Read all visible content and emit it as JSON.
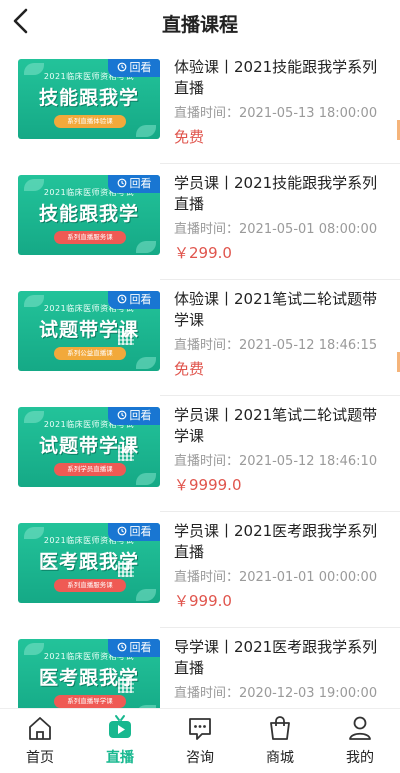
{
  "header": {
    "title": "直播课程"
  },
  "courses": [
    {
      "title": "体验课丨2021技能跟我学系列直播",
      "time_label": "直播时间：",
      "time": "2021-05-13 18:00:00",
      "price": "免费",
      "badge": "回看",
      "thumb": {
        "subtitle": "2021临床医师资格考试",
        "big": "技能跟我学",
        "pill": "系列直播体验课",
        "pill_color": "#f2a93b"
      }
    },
    {
      "title": "学员课丨2021技能跟我学系列直播",
      "time_label": "直播时间：",
      "time": "2021-05-01 08:00:00",
      "price": "￥299.0",
      "badge": "回看",
      "thumb": {
        "subtitle": "2021临床医师资格考试",
        "big": "技能跟我学",
        "pill": "系列直播服务课",
        "pill_color": "#ef5a54"
      }
    },
    {
      "title": "体验课丨2021笔试二轮试题带学课",
      "time_label": "直播时间：",
      "time": "2021-05-12 18:46:15",
      "price": "免费",
      "badge": "回看",
      "thumb": {
        "subtitle": "2021临床医师资格考试",
        "big": "试题带学课",
        "pill": "系列公益直播课",
        "pill_color": "#f2a93b"
      }
    },
    {
      "title": "学员课丨2021笔试二轮试题带学课",
      "time_label": "直播时间：",
      "time": "2021-05-12 18:46:10",
      "price": "￥9999.0",
      "badge": "回看",
      "thumb": {
        "subtitle": "2021临床医师资格考试",
        "big": "试题带学课",
        "pill": "系列学员直播课",
        "pill_color": "#ef5a54"
      }
    },
    {
      "title": "学员课丨2021医考跟我学系列直播",
      "time_label": "直播时间：",
      "time": "2021-01-01 00:00:00",
      "price": "￥999.0",
      "badge": "回看",
      "thumb": {
        "subtitle": "2021临床医师资格考试",
        "big": "医考跟我学",
        "pill": "系列直播服务课",
        "pill_color": "#ef5a54"
      }
    },
    {
      "title": "导学课丨2021医考跟我学系列直播",
      "time_label": "直播时间：",
      "time": "2020-12-03 19:00:00",
      "price": "",
      "badge": "回看",
      "thumb": {
        "subtitle": "2021临床医师资格考试",
        "big": "医考跟我学",
        "pill": "系列直播导学课",
        "pill_color": "#ef5a54"
      }
    }
  ],
  "tabs": [
    {
      "label": "首页",
      "icon": "home-icon"
    },
    {
      "label": "直播",
      "icon": "live-tv-icon",
      "active": true
    },
    {
      "label": "咨询",
      "icon": "chat-icon"
    },
    {
      "label": "商城",
      "icon": "shopping-bag-icon"
    },
    {
      "label": "我的",
      "icon": "user-icon"
    }
  ],
  "colors": {
    "accent": "#18b88f",
    "price": "#e0554d",
    "badge": "#1976d2"
  }
}
